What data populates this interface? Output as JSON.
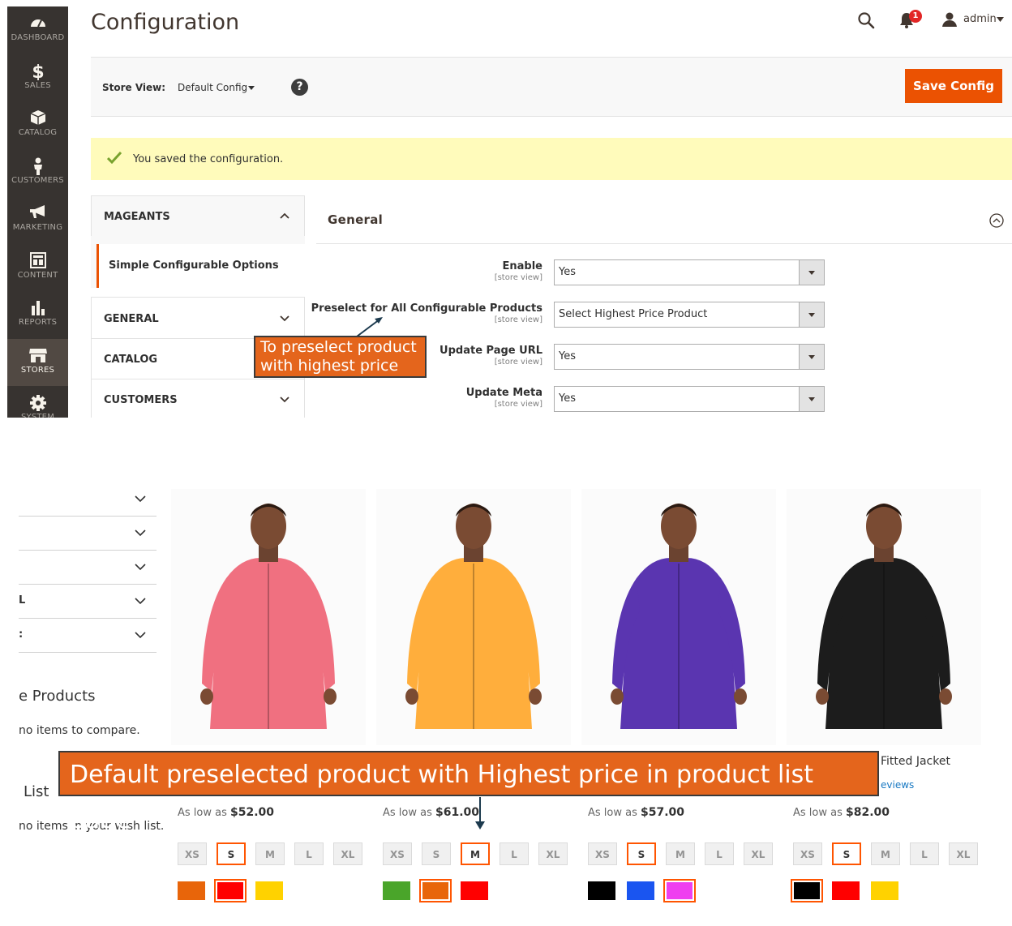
{
  "admin_nav": [
    {
      "label": "DASHBOARD",
      "icon": "dashboard-icon"
    },
    {
      "label": "SALES",
      "icon": "dollar-icon"
    },
    {
      "label": "CATALOG",
      "icon": "cube-icon"
    },
    {
      "label": "CUSTOMERS",
      "icon": "person-icon"
    },
    {
      "label": "MARKETING",
      "icon": "megaphone-icon"
    },
    {
      "label": "CONTENT",
      "icon": "layout-icon"
    },
    {
      "label": "REPORTS",
      "icon": "bar-chart-icon"
    },
    {
      "label": "STORES",
      "icon": "store-icon"
    },
    {
      "label": "SYSTEM",
      "icon": "gear-icon"
    }
  ],
  "header": {
    "title": "Configuration",
    "notifications_count": "1",
    "user": "admin"
  },
  "store_bar": {
    "label": "Store View:",
    "value": "Default Config",
    "help": "?",
    "save_label": "Save Config"
  },
  "message": {
    "text": "You saved the configuration."
  },
  "tabs": {
    "mageants": "MAGEANTS",
    "mageants_item": "Simple Configurable Options",
    "general": "GENERAL",
    "catalog": "CATALOG",
    "customers": "CUSTOMERS"
  },
  "section": {
    "title": "General",
    "fields": [
      {
        "label": "Enable",
        "scope": "[store view]",
        "value": "Yes"
      },
      {
        "label": "Preselect for All Configurable Products",
        "scope": "[store view]",
        "value": "Select Highest Price Product"
      },
      {
        "label": "Update Page URL",
        "scope": "[store view]",
        "value": "Yes"
      },
      {
        "label": "Update Meta",
        "scope": "[store view]",
        "value": "Yes"
      }
    ]
  },
  "callouts": {
    "top_line1": "To preselect product",
    "top_line2": "with highest price",
    "bottom": "Default preselected product with Highest price in product list page"
  },
  "storefront": {
    "sidebar_fragments": [
      "L",
      ":"
    ],
    "compare_title": "e Products",
    "compare_text": "no items to compare.",
    "wishlist_title": "List",
    "wishlist_text": "no items in your wish list.",
    "product_name_fragment": "Fitted Jacket",
    "reviews_fragment": "eviews",
    "price_prefix": "As low as",
    "products": [
      {
        "price": "$52.00",
        "selected_size": "S",
        "colors": [
          "#e8650a",
          "#ff0000",
          "#ffd200"
        ],
        "selected_color": 1,
        "jacket_color": "#f07080"
      },
      {
        "price": "$61.00",
        "selected_size": "M",
        "colors": [
          "#4aa52a",
          "#e8650a",
          "#ff0000"
        ],
        "selected_color": 1,
        "jacket_color": "#ffae3c"
      },
      {
        "price": "$57.00",
        "selected_size": "S",
        "colors": [
          "#000000",
          "#1a55f0",
          "#ef3ef0"
        ],
        "selected_color": 2,
        "jacket_color": "#5a35b0"
      },
      {
        "price": "$82.00",
        "selected_size": "S",
        "colors": [
          "#000000",
          "#ff0000",
          "#ffd200"
        ],
        "selected_color": 0,
        "jacket_color": "#1c1c1c"
      }
    ],
    "sizes": [
      "XS",
      "S",
      "M",
      "L",
      "XL"
    ]
  },
  "colors": {
    "accent": "#eb5202",
    "callout": "#e4651c",
    "message_bg": "#fffbbb",
    "nav_bg": "#373330"
  }
}
